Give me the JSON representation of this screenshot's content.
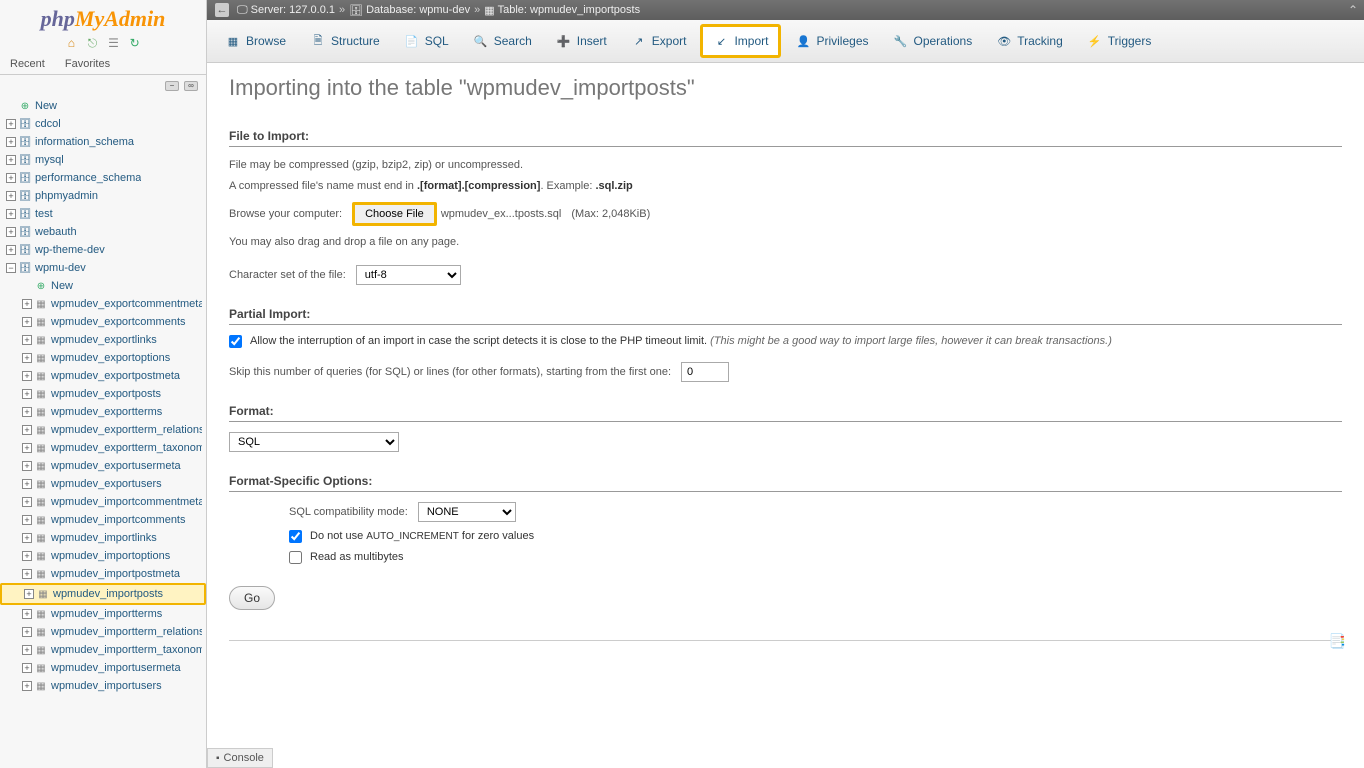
{
  "logo": {
    "php": "php",
    "myadmin": "MyAdmin"
  },
  "sidebar_tabs": {
    "recent": "Recent",
    "favorites": "Favorites"
  },
  "tree": {
    "new": "New",
    "dbs": [
      "cdcol",
      "information_schema",
      "mysql",
      "performance_schema",
      "phpmyadmin",
      "test",
      "webauth",
      "wp-theme-dev",
      "wpmu-dev"
    ],
    "expanded_db": "wpmu-dev",
    "new_table": "New",
    "tables": [
      "wpmudev_exportcommentmeta",
      "wpmudev_exportcomments",
      "wpmudev_exportlinks",
      "wpmudev_exportoptions",
      "wpmudev_exportpostmeta",
      "wpmudev_exportposts",
      "wpmudev_exportterms",
      "wpmudev_exportterm_relationships",
      "wpmudev_exportterm_taxonomy",
      "wpmudev_exportusermeta",
      "wpmudev_exportusers",
      "wpmudev_importcommentmeta",
      "wpmudev_importcomments",
      "wpmudev_importlinks",
      "wpmudev_importoptions",
      "wpmudev_importpostmeta",
      "wpmudev_importposts",
      "wpmudev_importterms",
      "wpmudev_importterm_relationships",
      "wpmudev_importterm_taxonomy",
      "wpmudev_importusermeta",
      "wpmudev_importusers"
    ],
    "highlighted_table": "wpmudev_importposts"
  },
  "breadcrumb": {
    "server_label": "Server:",
    "server": "127.0.0.1",
    "db_label": "Database:",
    "db": "wpmu-dev",
    "table_label": "Table:",
    "table": "wpmudev_importposts"
  },
  "nav": {
    "browse": "Browse",
    "structure": "Structure",
    "sql": "SQL",
    "search": "Search",
    "insert": "Insert",
    "export": "Export",
    "import": "Import",
    "privileges": "Privileges",
    "operations": "Operations",
    "tracking": "Tracking",
    "triggers": "Triggers"
  },
  "page_title": "Importing into the table \"wpmudev_importposts\"",
  "file_import": {
    "heading": "File to Import:",
    "line1a": "File may be compressed (gzip, bzip2, zip) or uncompressed.",
    "line2a": "A compressed file's name must end in ",
    "line2b": ".[format].[compression]",
    "line2c": ". Example: ",
    "line2d": ".sql.zip",
    "browse_label": "Browse your computer:",
    "choose_file": "Choose File",
    "file_name": "wpmudev_ex...tposts.sql",
    "max": "(Max: 2,048KiB)",
    "dragdrop": "You may also drag and drop a file on any page.",
    "charset_label": "Character set of the file:",
    "charset_value": "utf-8"
  },
  "partial": {
    "heading": "Partial Import:",
    "allow_label": "Allow the interruption of an import in case the script detects it is close to the PHP timeout limit. ",
    "allow_note": "(This might be a good way to import large files, however it can break transactions.)",
    "skip_label": "Skip this number of queries (for SQL) or lines (for other formats), starting from the first one:",
    "skip_value": "0"
  },
  "format": {
    "heading": "Format:",
    "value": "SQL"
  },
  "options": {
    "heading": "Format-Specific Options:",
    "compat_label": "SQL compatibility mode:",
    "compat_value": "NONE",
    "autoincr_a": "Do not use ",
    "autoincr_b": "AUTO_INCREMENT",
    "autoincr_c": " for zero values",
    "multibytes": "Read as multibytes"
  },
  "go": "Go",
  "console": "Console"
}
